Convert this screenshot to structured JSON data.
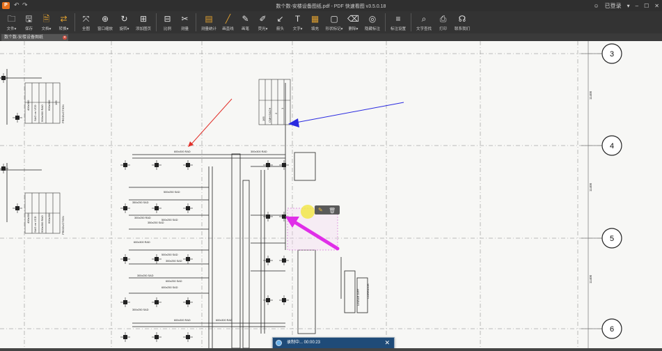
{
  "window": {
    "title": "数个数-安楼设备图纸.pdf - PDF 快速看图 v3.5.0.18",
    "logo_text": "P",
    "login_label": "已登录",
    "controls": {
      "pin": "▾",
      "minimize": "–",
      "maximize": "☐",
      "close": "✕"
    }
  },
  "toolbar": {
    "items": [
      {
        "label": "文件▾",
        "icon": "folder-icon",
        "glyph": "🗀"
      },
      {
        "label": "保存",
        "icon": "save-icon",
        "glyph": "🖫"
      },
      {
        "label": "文档▾",
        "icon": "document-icon",
        "glyph": "🗎",
        "orange": true
      },
      {
        "label": "转换▾",
        "icon": "convert-icon",
        "glyph": "⇄",
        "orange": true
      },
      {
        "label": "全图",
        "icon": "fit-all-icon",
        "glyph": "⤧"
      },
      {
        "label": "窗口缩放",
        "icon": "zoom-window-icon",
        "glyph": "⊕"
      },
      {
        "label": "旋转▾",
        "icon": "rotate-icon",
        "glyph": "↻"
      },
      {
        "label": "添加图页",
        "icon": "add-page-icon",
        "glyph": "⊞"
      },
      {
        "label": "比例",
        "icon": "scale-icon",
        "glyph": "⊟"
      },
      {
        "label": "测量",
        "icon": "measure-icon",
        "glyph": "✂"
      },
      {
        "label": "测量统计",
        "icon": "measure-stats-icon",
        "glyph": "▤",
        "orange": true
      },
      {
        "label": "画直线",
        "icon": "line-icon",
        "glyph": "╱",
        "orange": true
      },
      {
        "label": "画笔",
        "icon": "pen-icon",
        "glyph": "✎"
      },
      {
        "label": "荧光▾",
        "icon": "highlighter-icon",
        "glyph": "✐"
      },
      {
        "label": "箭头",
        "icon": "arrow-icon",
        "glyph": "↙"
      },
      {
        "label": "文字▾",
        "icon": "text-icon",
        "glyph": "T"
      },
      {
        "label": "填充",
        "icon": "fill-icon",
        "glyph": "▦",
        "orange": true
      },
      {
        "label": "形状标记▾",
        "icon": "shape-mark-icon",
        "glyph": "▢"
      },
      {
        "label": "删除▾",
        "icon": "eraser-icon",
        "glyph": "⌫"
      },
      {
        "label": "隐藏标注",
        "icon": "hide-annotation-icon",
        "glyph": "◎"
      },
      {
        "label": "标注设置",
        "icon": "annotation-settings-icon",
        "glyph": "≡"
      },
      {
        "label": "文字查找",
        "icon": "text-search-icon",
        "glyph": "⌕"
      },
      {
        "label": "打印",
        "icon": "print-icon",
        "glyph": "⎙"
      },
      {
        "label": "联系我们",
        "icon": "headset-icon",
        "glyph": "☊"
      }
    ]
  },
  "tabs": [
    {
      "label": "数个数-安楼设备图纸",
      "close": "✕"
    }
  ],
  "drawing": {
    "grid_labels": [
      "3",
      "4",
      "5",
      "6"
    ],
    "dimension_labels": [
      "11400",
      "11400",
      "11400"
    ],
    "duct_labels": [
      "600x300 RAD",
      "300x300 RAD",
      "600x300 RAD",
      "600x300 RAD",
      "500x250 SAD",
      "350x250 SAD",
      "500x250 SAD",
      "300x250 RAD",
      "350x250 SAD",
      "500x250 SAD",
      "600x300 RAD",
      "300x250 SAD",
      "600x250 SAD",
      "300x250 SAD",
      "300x250 SAD",
      "600x250 SAD"
    ],
    "schedule_text": [
      "PRODUCTION",
      "400x300",
      "SAG on VCD",
      "500x300 RAD",
      "600x300",
      "165",
      "CMH EACH",
      "2",
      "1",
      "CORRIDOR",
      "LINEAR DIFF"
    ],
    "annotation_colors": {
      "red_arrow": "#e2312b",
      "blue_arrow": "#2a2ae0",
      "magenta_arrow": "#e02ee8",
      "highlight": "#f2e84a"
    }
  },
  "recorder": {
    "status": "录制中... 00:00:23",
    "close": "✕",
    "buttons": [
      "pause-icon",
      "stop-icon",
      "volume-icon",
      "webcam-icon",
      "pen-icon"
    ]
  }
}
